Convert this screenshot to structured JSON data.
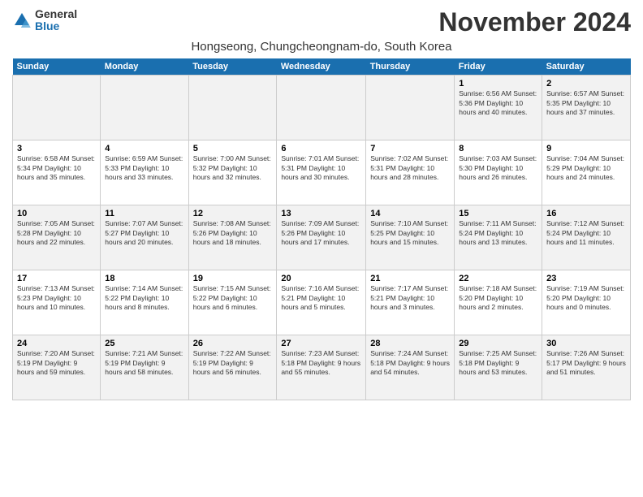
{
  "logo": {
    "general": "General",
    "blue": "Blue"
  },
  "title": "November 2024",
  "subtitle": "Hongseong, Chungcheongnam-do, South Korea",
  "days_of_week": [
    "Sunday",
    "Monday",
    "Tuesday",
    "Wednesday",
    "Thursday",
    "Friday",
    "Saturday"
  ],
  "weeks": [
    [
      {
        "day": "",
        "info": ""
      },
      {
        "day": "",
        "info": ""
      },
      {
        "day": "",
        "info": ""
      },
      {
        "day": "",
        "info": ""
      },
      {
        "day": "",
        "info": ""
      },
      {
        "day": "1",
        "info": "Sunrise: 6:56 AM\nSunset: 5:36 PM\nDaylight: 10 hours\nand 40 minutes."
      },
      {
        "day": "2",
        "info": "Sunrise: 6:57 AM\nSunset: 5:35 PM\nDaylight: 10 hours\nand 37 minutes."
      }
    ],
    [
      {
        "day": "3",
        "info": "Sunrise: 6:58 AM\nSunset: 5:34 PM\nDaylight: 10 hours\nand 35 minutes."
      },
      {
        "day": "4",
        "info": "Sunrise: 6:59 AM\nSunset: 5:33 PM\nDaylight: 10 hours\nand 33 minutes."
      },
      {
        "day": "5",
        "info": "Sunrise: 7:00 AM\nSunset: 5:32 PM\nDaylight: 10 hours\nand 32 minutes."
      },
      {
        "day": "6",
        "info": "Sunrise: 7:01 AM\nSunset: 5:31 PM\nDaylight: 10 hours\nand 30 minutes."
      },
      {
        "day": "7",
        "info": "Sunrise: 7:02 AM\nSunset: 5:31 PM\nDaylight: 10 hours\nand 28 minutes."
      },
      {
        "day": "8",
        "info": "Sunrise: 7:03 AM\nSunset: 5:30 PM\nDaylight: 10 hours\nand 26 minutes."
      },
      {
        "day": "9",
        "info": "Sunrise: 7:04 AM\nSunset: 5:29 PM\nDaylight: 10 hours\nand 24 minutes."
      }
    ],
    [
      {
        "day": "10",
        "info": "Sunrise: 7:05 AM\nSunset: 5:28 PM\nDaylight: 10 hours\nand 22 minutes."
      },
      {
        "day": "11",
        "info": "Sunrise: 7:07 AM\nSunset: 5:27 PM\nDaylight: 10 hours\nand 20 minutes."
      },
      {
        "day": "12",
        "info": "Sunrise: 7:08 AM\nSunset: 5:26 PM\nDaylight: 10 hours\nand 18 minutes."
      },
      {
        "day": "13",
        "info": "Sunrise: 7:09 AM\nSunset: 5:26 PM\nDaylight: 10 hours\nand 17 minutes."
      },
      {
        "day": "14",
        "info": "Sunrise: 7:10 AM\nSunset: 5:25 PM\nDaylight: 10 hours\nand 15 minutes."
      },
      {
        "day": "15",
        "info": "Sunrise: 7:11 AM\nSunset: 5:24 PM\nDaylight: 10 hours\nand 13 minutes."
      },
      {
        "day": "16",
        "info": "Sunrise: 7:12 AM\nSunset: 5:24 PM\nDaylight: 10 hours\nand 11 minutes."
      }
    ],
    [
      {
        "day": "17",
        "info": "Sunrise: 7:13 AM\nSunset: 5:23 PM\nDaylight: 10 hours\nand 10 minutes."
      },
      {
        "day": "18",
        "info": "Sunrise: 7:14 AM\nSunset: 5:22 PM\nDaylight: 10 hours\nand 8 minutes."
      },
      {
        "day": "19",
        "info": "Sunrise: 7:15 AM\nSunset: 5:22 PM\nDaylight: 10 hours\nand 6 minutes."
      },
      {
        "day": "20",
        "info": "Sunrise: 7:16 AM\nSunset: 5:21 PM\nDaylight: 10 hours\nand 5 minutes."
      },
      {
        "day": "21",
        "info": "Sunrise: 7:17 AM\nSunset: 5:21 PM\nDaylight: 10 hours\nand 3 minutes."
      },
      {
        "day": "22",
        "info": "Sunrise: 7:18 AM\nSunset: 5:20 PM\nDaylight: 10 hours\nand 2 minutes."
      },
      {
        "day": "23",
        "info": "Sunrise: 7:19 AM\nSunset: 5:20 PM\nDaylight: 10 hours\nand 0 minutes."
      }
    ],
    [
      {
        "day": "24",
        "info": "Sunrise: 7:20 AM\nSunset: 5:19 PM\nDaylight: 9 hours\nand 59 minutes."
      },
      {
        "day": "25",
        "info": "Sunrise: 7:21 AM\nSunset: 5:19 PM\nDaylight: 9 hours\nand 58 minutes."
      },
      {
        "day": "26",
        "info": "Sunrise: 7:22 AM\nSunset: 5:19 PM\nDaylight: 9 hours\nand 56 minutes."
      },
      {
        "day": "27",
        "info": "Sunrise: 7:23 AM\nSunset: 5:18 PM\nDaylight: 9 hours\nand 55 minutes."
      },
      {
        "day": "28",
        "info": "Sunrise: 7:24 AM\nSunset: 5:18 PM\nDaylight: 9 hours\nand 54 minutes."
      },
      {
        "day": "29",
        "info": "Sunrise: 7:25 AM\nSunset: 5:18 PM\nDaylight: 9 hours\nand 53 minutes."
      },
      {
        "day": "30",
        "info": "Sunrise: 7:26 AM\nSunset: 5:17 PM\nDaylight: 9 hours\nand 51 minutes."
      }
    ]
  ]
}
